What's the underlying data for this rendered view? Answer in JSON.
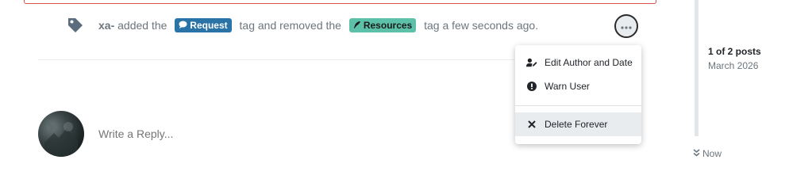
{
  "event": {
    "username": "xa-",
    "text_added": " added the ",
    "tag_added": "Request",
    "text_removed": " tag and removed the ",
    "tag_removed": "Resources",
    "text_time": " tag a few seconds ago.",
    "icon": "tag-icon",
    "tag_added_color": "#2a73a6",
    "tag_removed_color": "#5cc1a8"
  },
  "post_menu": {
    "toggle_icon": "ellipsis-icon",
    "items": [
      {
        "label": "Edit Author and Date",
        "icon": "user-edit-icon"
      },
      {
        "label": "Warn User",
        "icon": "exclamation-circle-icon"
      },
      {
        "label": "Delete Forever",
        "icon": "times-icon"
      }
    ]
  },
  "reply": {
    "placeholder": "Write a Reply..."
  },
  "pagination": {
    "label": "1 of 2 posts",
    "date": "March 2026",
    "now_label": "Now",
    "now_icon": "double-chevron-down-icon"
  },
  "colors": {
    "error_border": "#d9534f",
    "menu_hover": "#e9ecef"
  }
}
